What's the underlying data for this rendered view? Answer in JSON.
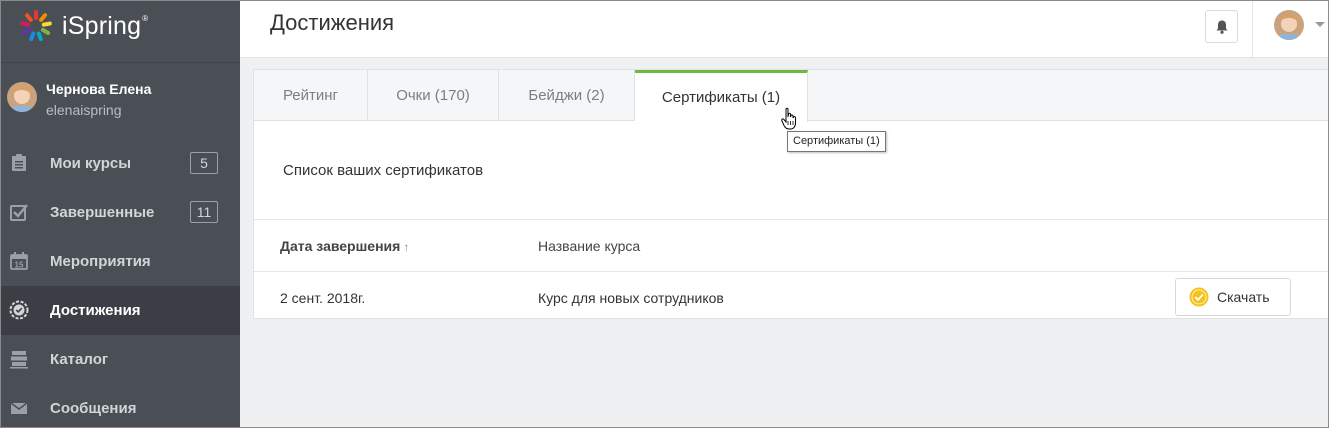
{
  "brand": {
    "name": "iSpring",
    "mark": "®"
  },
  "user": {
    "name": "Чернова Елена",
    "login": "elenaispring"
  },
  "nav": [
    {
      "label": "Мои курсы",
      "badge": "5",
      "icon": "courses-icon"
    },
    {
      "label": "Завершенные",
      "badge": "11",
      "icon": "checkbox-icon"
    },
    {
      "label": "Мероприятия",
      "badge": "",
      "icon": "calendar-icon",
      "icon_text": "15"
    },
    {
      "label": "Достижения",
      "badge": "",
      "icon": "achievements-icon",
      "active": true
    },
    {
      "label": "Каталог",
      "badge": "",
      "icon": "catalog-icon"
    },
    {
      "label": "Сообщения",
      "badge": "",
      "icon": "envelope-icon"
    }
  ],
  "header": {
    "title": "Достижения"
  },
  "tabs": [
    {
      "label": "Рейтинг"
    },
    {
      "label": "Очки (170)"
    },
    {
      "label": "Бейджи (2)"
    },
    {
      "label": "Сертификаты (1)",
      "active": true
    }
  ],
  "certificates": {
    "description": "Список ваших сертификатов",
    "columns": {
      "date": "Дата завершения",
      "sort": "↑",
      "name": "Название курса"
    },
    "rows": [
      {
        "date": "2 сент. 2018г.",
        "course": "Курс для новых сотрудников",
        "action": "Скачать"
      }
    ]
  },
  "tooltip": "Сертификаты (1)",
  "colors": {
    "sidebar": "#4a4f56",
    "sidebar_active": "#3b3f45",
    "accent": "#6cbb3e",
    "background": "#eef0f1"
  }
}
